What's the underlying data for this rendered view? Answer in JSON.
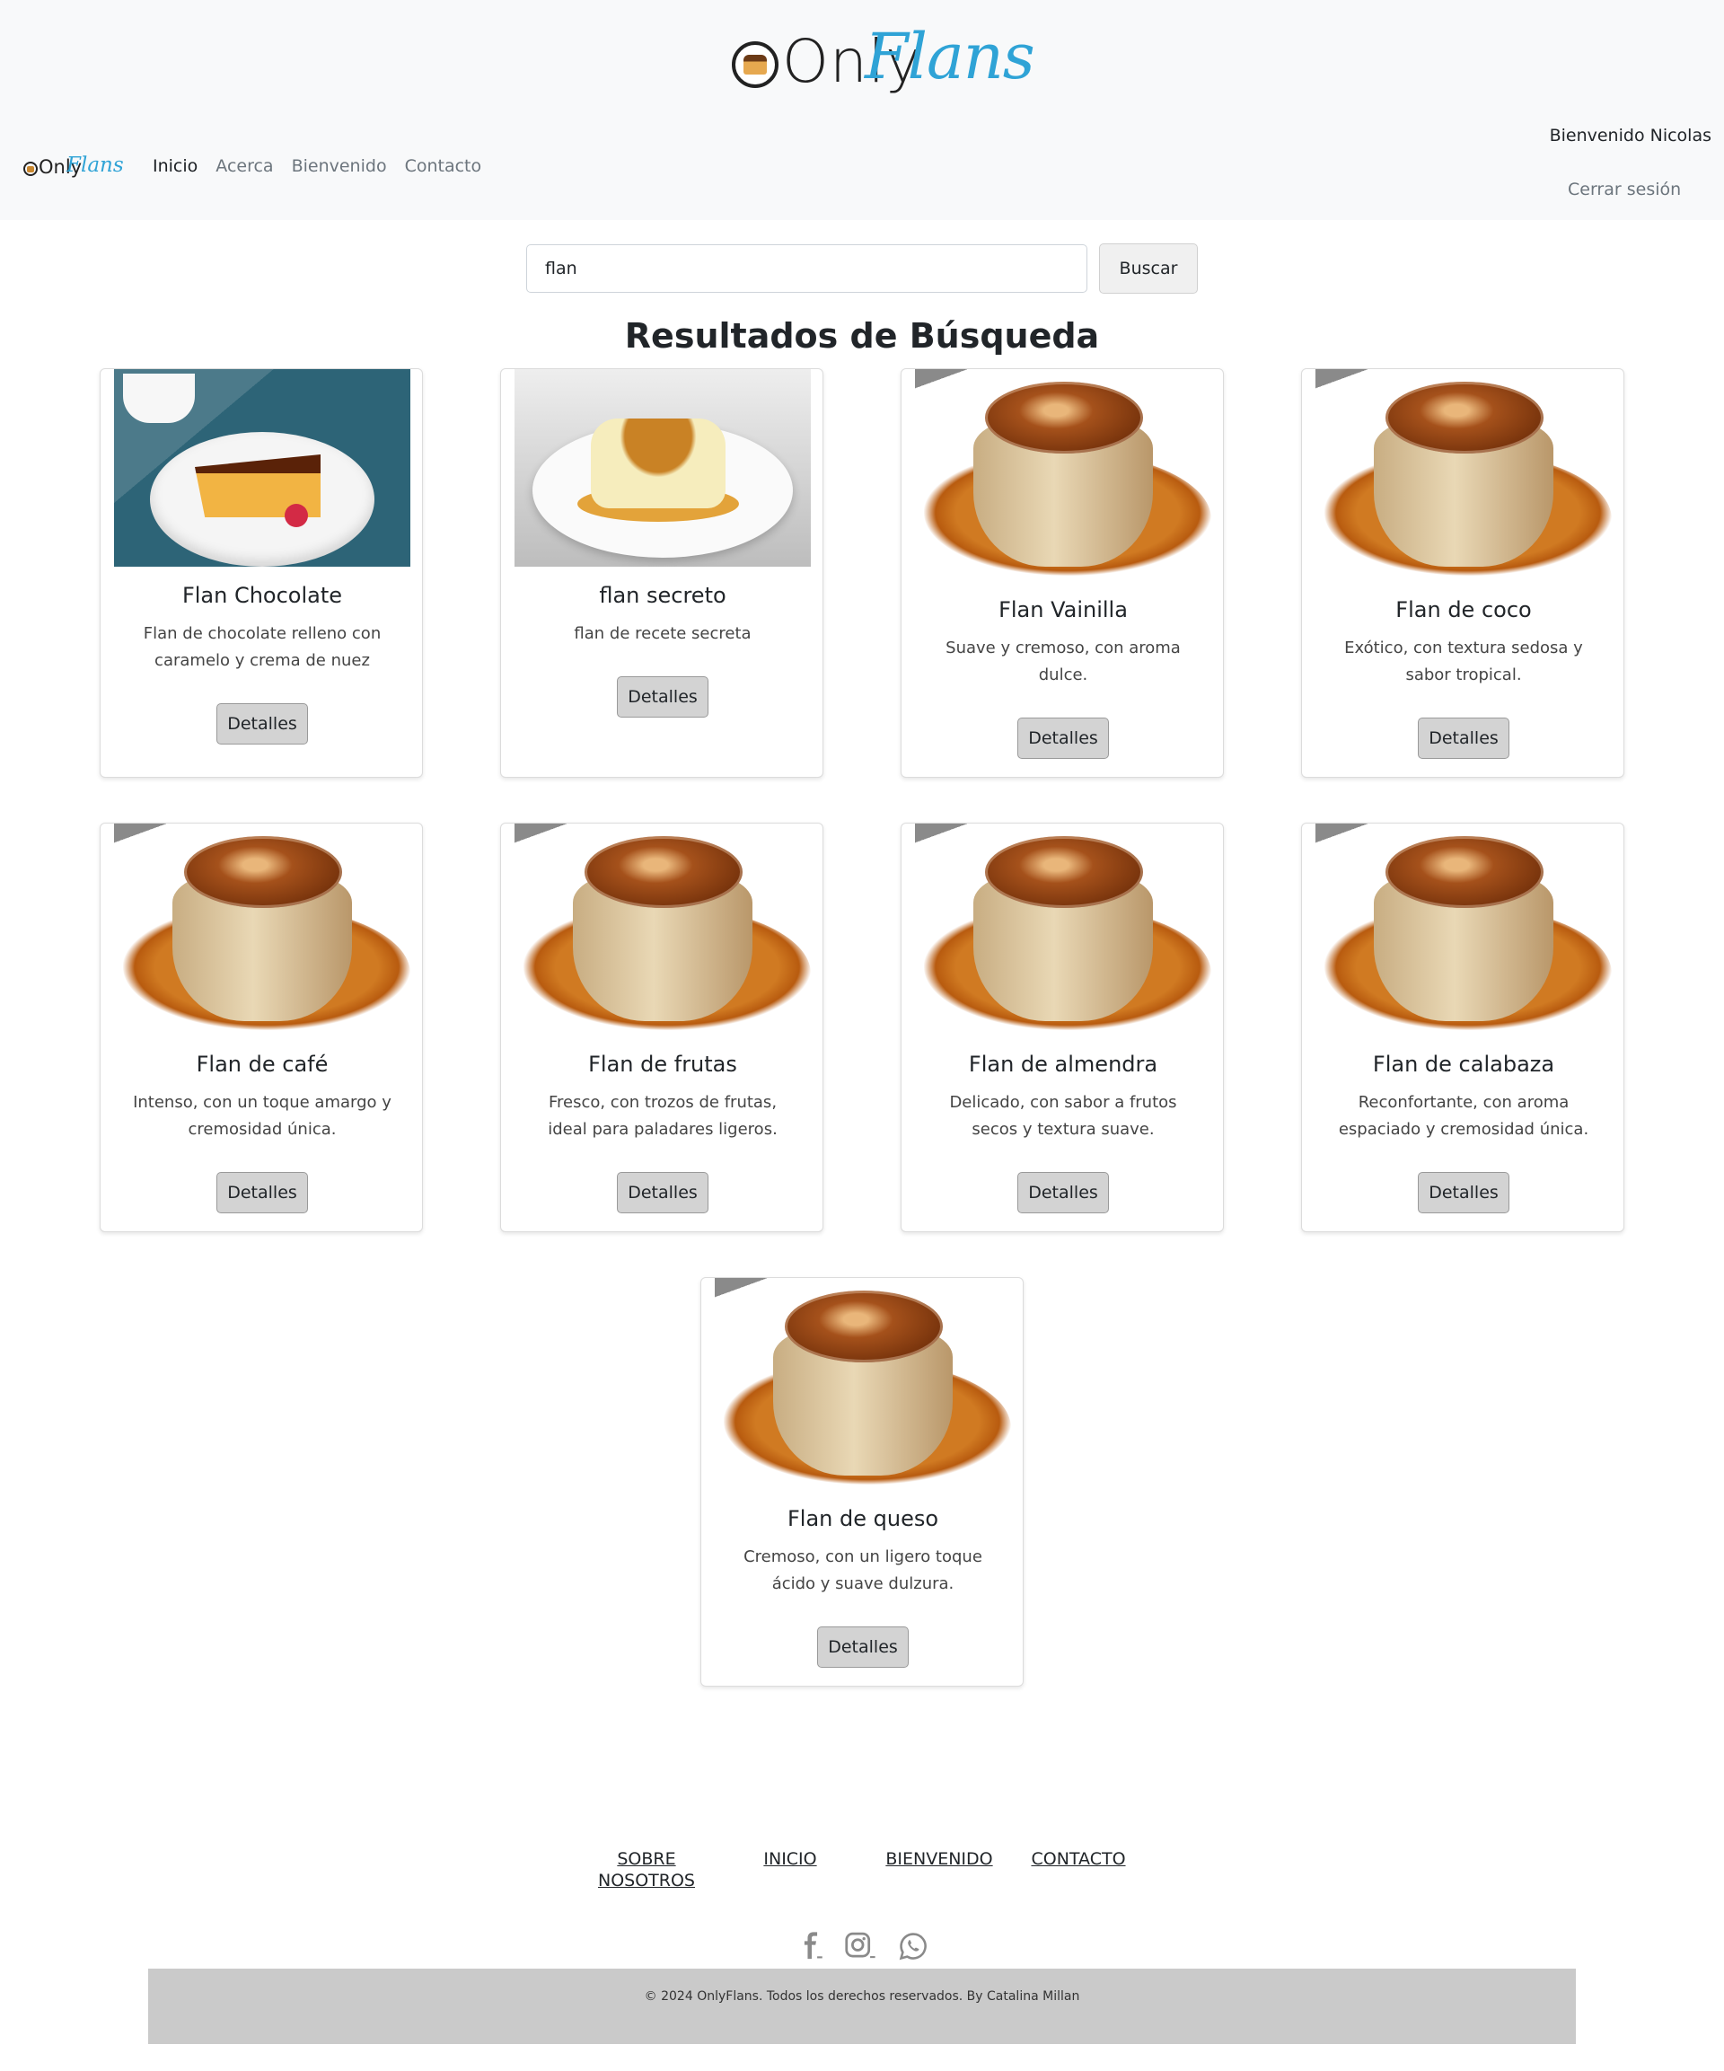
{
  "header": {
    "brand_only": "Only",
    "brand_flans": "Flans",
    "nav": [
      {
        "label": "Inicio"
      },
      {
        "label": "Acerca"
      },
      {
        "label": "Bienvenido"
      },
      {
        "label": "Contacto"
      }
    ],
    "welcome": "Bienvenido Nicolas",
    "logout": "Cerrar sesión"
  },
  "search": {
    "value": "flan",
    "button": "Buscar"
  },
  "results": {
    "heading": "Resultados de Búsqueda",
    "cards": [
      {
        "title": "Flan Chocolate",
        "desc": "Flan de chocolate relleno con caramelo y crema de nuez",
        "button": "Detalles",
        "image": "chocolate-flan-photo"
      },
      {
        "title": "flan secreto",
        "desc": "flan de recete secreta",
        "button": "Detalles",
        "image": "caramel-flan-plate-photo"
      },
      {
        "title": "Flan Vainilla",
        "desc": "Suave y cremoso, con aroma dulce.",
        "button": "Detalles",
        "image": "flan-photo"
      },
      {
        "title": "Flan de coco",
        "desc": "Exótico, con textura sedosa y sabor tropical.",
        "button": "Detalles",
        "image": "flan-photo"
      },
      {
        "title": "Flan de café",
        "desc": "Intenso, con un toque amargo y cremosidad única.",
        "button": "Detalles",
        "image": "flan-photo"
      },
      {
        "title": "Flan de frutas",
        "desc": "Fresco, con trozos de frutas, ideal para paladares ligeros.",
        "button": "Detalles",
        "image": "flan-photo"
      },
      {
        "title": "Flan de almendra",
        "desc": "Delicado, con sabor a frutos secos y textura suave.",
        "button": "Detalles",
        "image": "flan-photo"
      },
      {
        "title": "Flan de calabaza",
        "desc": "Reconfortante, con aroma espaciado y cremosidad única.",
        "button": "Detalles",
        "image": "flan-photo"
      },
      {
        "title": "Flan de queso",
        "desc": "Cremoso, con un ligero toque ácido y suave dulzura.",
        "button": "Detalles",
        "image": "flan-photo"
      }
    ]
  },
  "footer": {
    "links": [
      "SOBRE NOSOTROS",
      "INICIO",
      "BIENVENIDO",
      "CONTACTO"
    ],
    "social_icons": [
      "facebook-icon",
      "instagram-icon",
      "whatsapp-icon"
    ],
    "copyright": "© 2024 OnlyFlans. Todos los derechos reservados. By Catalina Millan"
  },
  "colors": {
    "brand_blue": "#2fa3d6",
    "header_bg": "#f8f9fa",
    "button_bg": "#d3d3d3",
    "footer_bar": "#cacaca"
  }
}
